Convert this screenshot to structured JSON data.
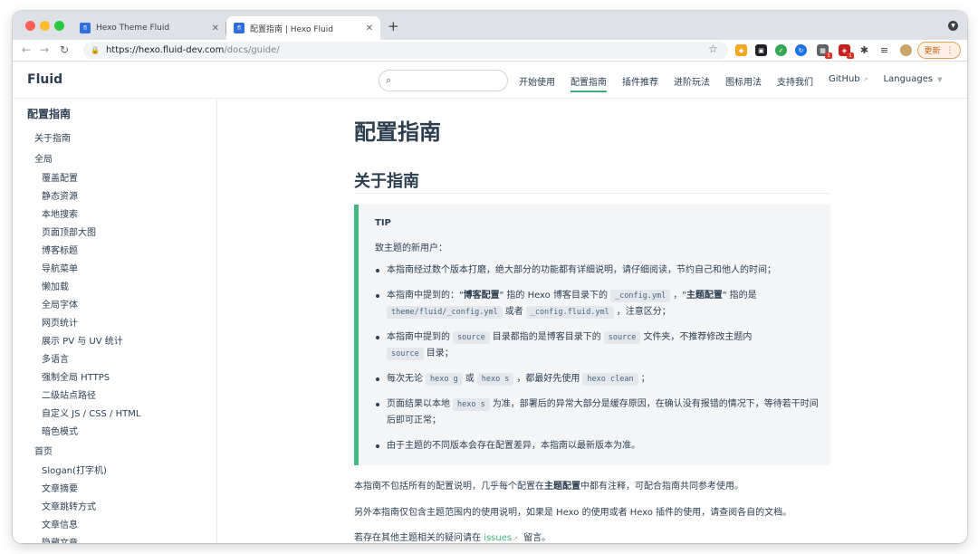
{
  "browser": {
    "tabs": [
      {
        "title": "Hexo Theme Fluid",
        "favicon": "fluid",
        "active": false
      },
      {
        "title": "配置指南 | Hexo Fluid",
        "favicon": "fluid",
        "active": true
      }
    ],
    "url": {
      "host": "https://hexo.fluid-dev.com",
      "path": "/docs/guide/"
    },
    "update_label": "更新",
    "extension_badges": [
      "3",
      "1"
    ]
  },
  "site": {
    "brand": "Fluid",
    "search_placeholder": "",
    "nav": [
      {
        "label": "开始使用",
        "active": false
      },
      {
        "label": "配置指南",
        "active": true
      },
      {
        "label": "插件推荐",
        "active": false
      },
      {
        "label": "进阶玩法",
        "active": false
      },
      {
        "label": "图标用法",
        "active": false
      },
      {
        "label": "支持我们",
        "active": false
      },
      {
        "label": "GitHub",
        "active": false
      },
      {
        "label": "Languages",
        "active": false
      }
    ],
    "accent_color": "#3eaf7c"
  },
  "sidebar": {
    "title": "配置指南",
    "items": [
      {
        "label": "关于指南",
        "level": 1
      },
      {
        "label": "全局",
        "level": 1
      },
      {
        "label": "覆盖配置",
        "level": 2
      },
      {
        "label": "静态资源",
        "level": 2
      },
      {
        "label": "本地搜索",
        "level": 2
      },
      {
        "label": "页面顶部大图",
        "level": 2
      },
      {
        "label": "博客标题",
        "level": 2
      },
      {
        "label": "导航菜单",
        "level": 2
      },
      {
        "label": "懒加载",
        "level": 2
      },
      {
        "label": "全局字体",
        "level": 2
      },
      {
        "label": "网页统计",
        "level": 2
      },
      {
        "label": "展示 PV 与 UV 统计",
        "level": 2
      },
      {
        "label": "多语言",
        "level": 2
      },
      {
        "label": "强制全局 HTTPS",
        "level": 2
      },
      {
        "label": "二级站点路径",
        "level": 2
      },
      {
        "label": "自定义 JS / CSS / HTML",
        "level": 2
      },
      {
        "label": "暗色模式",
        "level": 2
      },
      {
        "label": "首页",
        "level": 1
      },
      {
        "label": "Slogan(打字机)",
        "level": 2
      },
      {
        "label": "文章摘要",
        "level": 2
      },
      {
        "label": "文章跳转方式",
        "level": 2
      },
      {
        "label": "文章信息",
        "level": 2
      },
      {
        "label": "隐藏文章",
        "level": 2
      }
    ]
  },
  "content": {
    "h1": "配置指南",
    "h2": "关于指南",
    "tip": {
      "title": "TIP",
      "intro": "致主题的新用户：",
      "items": {
        "i1": {
          "text": "本指南经过数个版本打磨，绝大部分的功能都有详细说明，请仔细阅读，节约自己和他人的时间；"
        },
        "i2": {
          "t1": "本指南中提到的：\"",
          "b1": "博客配置",
          "t2": "\" 指的 Hexo 博客目录下的",
          "c1": "_config.yml",
          "t3": "，\"",
          "b2": "主题配置",
          "t4": "\" 指的是",
          "c2": "theme/fluid/_config.yml",
          "t5": "或者",
          "c3": "_config.fluid.yml",
          "t6": "，注意区分；"
        },
        "i3": {
          "t1": "本指南中提到的",
          "c1": "source",
          "t2": "目录都指的是博客目录下的",
          "c2": "source",
          "t3": "文件夹，不推荐修改主题内",
          "c3": "source",
          "t4": "目录；"
        },
        "i4": {
          "t1": "每次无论",
          "c1": "hexo g",
          "t2": "或",
          "c2": "hexo s",
          "t3": "，都最好先使用",
          "c3": "hexo clean",
          "t4": "；"
        },
        "i5": {
          "t1": "页面结果以本地",
          "c1": "hexo s",
          "t2": "为准，部署后的异常大部分是缓存原因，在确认没有报错的情况下，等待若干时间后即可正常；"
        },
        "i6": {
          "text": "由于主题的不同版本会存在配置差异，本指南以最新版本为准。"
        }
      }
    },
    "p1": {
      "t1": "本指南不包括所有的配置说明，几乎每个配置在",
      "b1": "主题配置",
      "t2": "中都有注释，可配合指南共同参考使用。"
    },
    "p2": {
      "text": "另外本指南仅包含主题范围内的使用说明，如果是 Hexo 的使用或者 Hexo 插件的使用，请查阅各自的文档。"
    },
    "p3": {
      "t1": "若存在其他主题相关的疑问请在",
      "link": "issues",
      "t2": "留言。"
    }
  }
}
